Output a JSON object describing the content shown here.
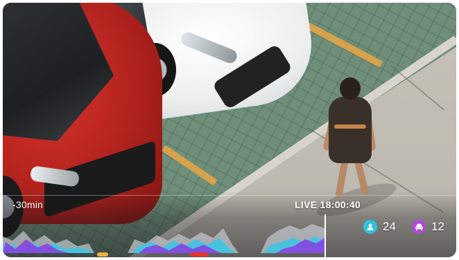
{
  "timeline": {
    "start_label": "-30min",
    "live_label": "LIVE 18:00:40"
  },
  "counters": {
    "people": {
      "icon": "person-icon",
      "value": "24",
      "color": "#2ec4dc"
    },
    "vehicles": {
      "icon": "car-icon",
      "value": "12",
      "color": "#b04ad8"
    }
  },
  "activity_colors": {
    "cyan": "#38c6e6",
    "purple": "#8c3ce0",
    "gray": "#bfc3c8"
  },
  "event_markers": [
    {
      "type": "person",
      "color": "#f3b13a"
    },
    {
      "type": "vehicle",
      "color": "#e8322e"
    }
  ]
}
